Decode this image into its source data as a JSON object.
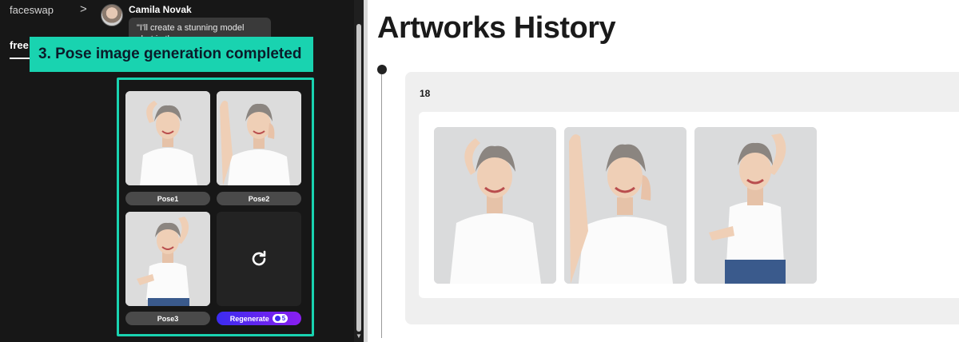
{
  "left_panel": {
    "breadcrumb": "faceswap",
    "chevron": ">",
    "user_name": "Camila Novak",
    "message_preview": "\"I'll create a stunning model shot in the ...",
    "active_tab": "free",
    "callout": "3. Pose image generation completed",
    "poses": [
      {
        "label": "Pose1"
      },
      {
        "label": "Pose2"
      },
      {
        "label": "Pose3"
      }
    ],
    "regenerate": {
      "label": "Regenerate",
      "credits": "5"
    }
  },
  "right_panel": {
    "title": "Artworks History",
    "group_label": "18",
    "artworks_count": 3
  },
  "colors": {
    "accent_teal": "#19d3b0",
    "left_bg": "#171717",
    "regen_gradient_start": "#3b2cf0",
    "regen_gradient_end": "#8a1ff0"
  }
}
